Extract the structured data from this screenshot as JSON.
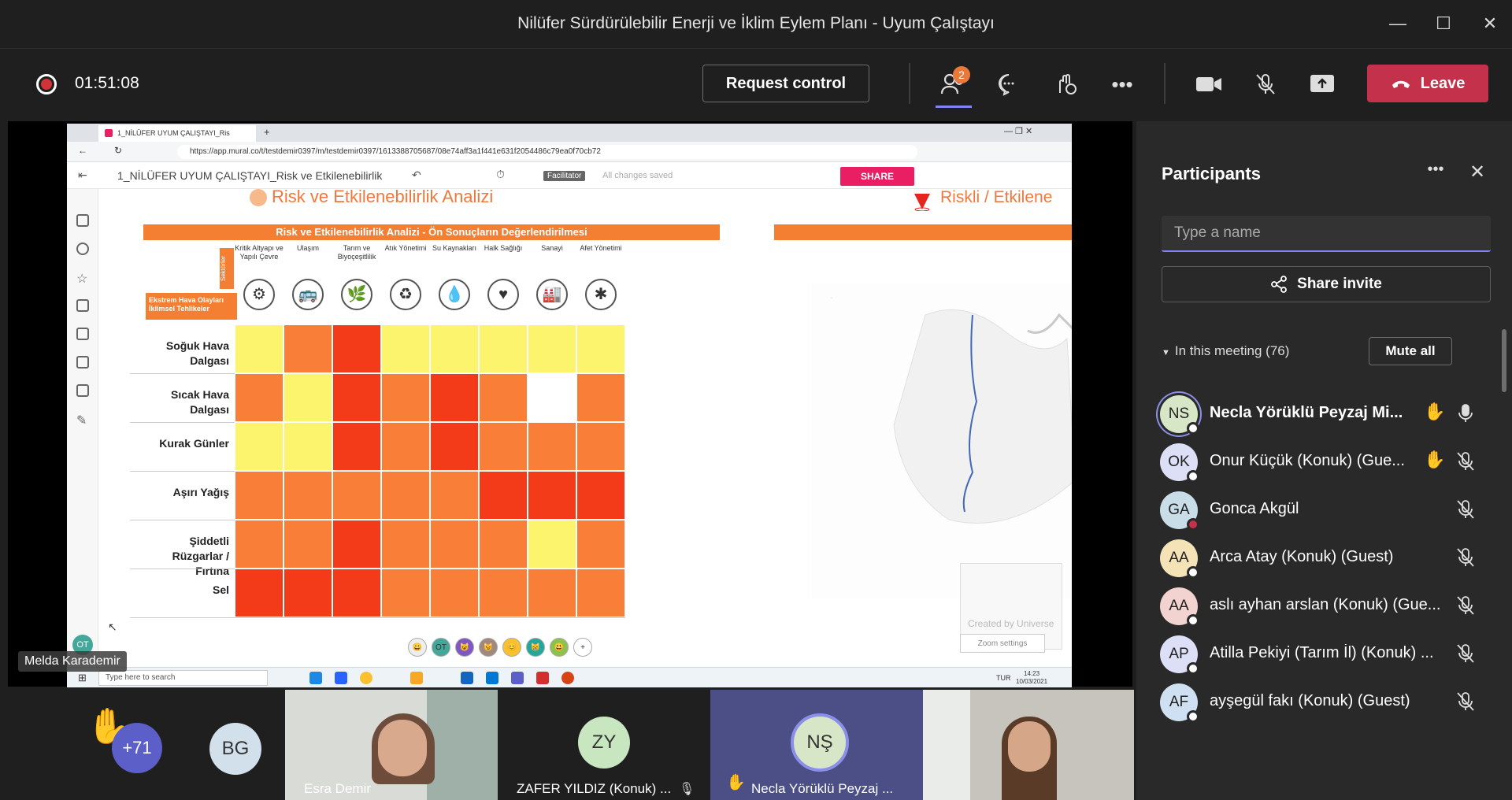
{
  "window": {
    "title": "Nilüfer Sürdürülebilir Enerji ve İklim Eylem Planı - Uyum Çalıştayı"
  },
  "toolbar": {
    "timer": "01:51:08",
    "request_control": "Request control",
    "participants_badge": "2",
    "leave": "Leave"
  },
  "browser": {
    "tab_title": "1_NİLÜFER UYUM ÇALIŞTAYI_Ris",
    "url": "https://app.mural.co/t/testdemir0397/m/testdemir0397/1613388705687/08e74aff3a1f441e631f2054486c79ea0f70cb72"
  },
  "mural": {
    "board_title": "1_NİLÜFER UYUM ÇALIŞTAYI_Risk ve Etkilenebilirlik",
    "facilitator": "Facilitator",
    "saved": "All changes saved",
    "share": "SHARE",
    "heading_left": "Risk ve Etkilenebilirlik Analizi",
    "heading_right": "Riskli / Etkilene",
    "bar_title": "Risk ve Etkilenebilirlik Analizi - Ön Sonuçların Değerlendirilmesi",
    "sector_tag": "Sektörler",
    "hazard_tag": "Ekstrem Hava Olayları İklimsel Tehlikeler",
    "columns": [
      {
        "label": "Kritik Altyapı ve Yapılı Çevre",
        "icon": "⚙"
      },
      {
        "label": "Ulaşım",
        "icon": "🚌"
      },
      {
        "label": "Tarım ve Biyoçeşitlilik",
        "icon": "🌿"
      },
      {
        "label": "Atık Yönetimi",
        "icon": "♻"
      },
      {
        "label": "Su Kaynakları",
        "icon": "💧"
      },
      {
        "label": "Halk Sağlığı",
        "icon": "♥"
      },
      {
        "label": "Sanayi",
        "icon": "🏭"
      },
      {
        "label": "Afet Yönetimi",
        "icon": "✱"
      }
    ],
    "rows": [
      {
        "label": "Soğuk Hava Dalgası",
        "levels": [
          "y",
          "o",
          "r",
          "y",
          "y",
          "y",
          "y",
          "y"
        ]
      },
      {
        "label": "Sıcak Hava Dalgası",
        "levels": [
          "o",
          "y",
          "r",
          "o",
          "r",
          "o",
          "w",
          "o"
        ]
      },
      {
        "label": "Kurak Günler",
        "levels": [
          "y",
          "y",
          "r",
          "o",
          "r",
          "o",
          "o",
          "o"
        ]
      },
      {
        "label": "Aşırı Yağış",
        "levels": [
          "o",
          "o",
          "o",
          "o",
          "o",
          "r",
          "r",
          "r"
        ]
      },
      {
        "label": "Şiddetli Rüzgarlar / Fırtına",
        "levels": [
          "o",
          "o",
          "r",
          "o",
          "o",
          "o",
          "y",
          "o"
        ]
      },
      {
        "label": "Sel",
        "levels": [
          "r",
          "r",
          "r",
          "o",
          "o",
          "o",
          "o",
          "o"
        ]
      }
    ],
    "colors": {
      "y": "#fdf46e",
      "o": "#f97f39",
      "r": "#f33a19",
      "w": "#ffffff"
    },
    "zoom_settings": "Zoom settings",
    "created_by": "Created by Universe",
    "avatars": [
      "😀",
      "OT",
      "😺",
      "😼",
      "😊",
      "😸",
      "😃",
      "+"
    ]
  },
  "taskbar": {
    "search": "Type here to search",
    "lang": "TUR",
    "time": "14:23",
    "date": "10/03/2021"
  },
  "presenter": {
    "name": "Melda Karademir",
    "initials": "OT"
  },
  "panel": {
    "title": "Participants",
    "search_placeholder": "Type a name",
    "share_invite": "Share invite",
    "in_meeting": "In this meeting (76)",
    "mute_all": "Mute all",
    "people": [
      {
        "initials": "NS",
        "name": "Necla Yörüklü Peyzaj Mi...",
        "color": "#d7e6c6",
        "hand": true,
        "muted": false,
        "speaking": true
      },
      {
        "initials": "OK",
        "name": "Onur Küçük (Konuk) (Gue...",
        "color": "#dcdff5",
        "hand": true,
        "muted": true
      },
      {
        "initials": "GA",
        "name": "Gonca Akgül",
        "color": "#c8dde8",
        "hand": false,
        "muted": true,
        "busy": true
      },
      {
        "initials": "AA",
        "name": "Arca Atay (Konuk) (Guest)",
        "color": "#f5e3b8",
        "hand": false,
        "muted": true
      },
      {
        "initials": "AA",
        "name": "aslı ayhan arslan (Konuk) (Gue...",
        "color": "#f3d3cf",
        "hand": false,
        "muted": true
      },
      {
        "initials": "AP",
        "name": "Atilla Pekiyi (Tarım İl) (Konuk) ...",
        "color": "#dcdff5",
        "hand": false,
        "muted": true
      },
      {
        "initials": "AF",
        "name": "ayşegül fakı (Konuk) (Guest)",
        "color": "#cfe0f2",
        "hand": false,
        "muted": true
      }
    ]
  },
  "strip": {
    "overflow": "+71",
    "tiles": [
      {
        "initials": "BG",
        "name": ""
      },
      {
        "initials": "",
        "name": "Esra Demir"
      },
      {
        "initials": "ZY",
        "name": "ZAFER YILDIZ (Konuk) ..."
      },
      {
        "initials": "NŞ",
        "name": "Necla Yörüklü Peyzaj ..."
      },
      {
        "initials": "",
        "name": ""
      }
    ]
  }
}
